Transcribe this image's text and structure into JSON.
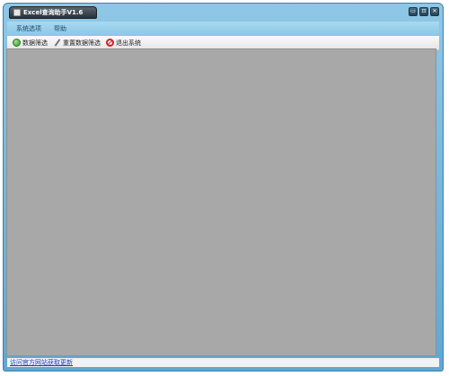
{
  "window": {
    "title": "Excel查询助手V1.6"
  },
  "window_controls": {
    "minimize_glyph": "▭",
    "restore_glyph": "⊡",
    "close_glyph": "✕"
  },
  "menubar": {
    "items": [
      {
        "label": "系统选项"
      },
      {
        "label": "帮助"
      }
    ]
  },
  "toolbar": {
    "items": [
      {
        "label": "数据筛选",
        "icon": "green-circle-icon"
      },
      {
        "label": "重置数据筛选",
        "icon": "pen-icon"
      },
      {
        "label": "退出系统",
        "icon": "no-entry-icon"
      }
    ]
  },
  "statusbar": {
    "link_text": "访问官方网站获取更新"
  },
  "colors": {
    "titlebar": "#5ea8d4",
    "menubar": "#a9d9f0",
    "workspace": "#a8a8a8",
    "link": "#1a3cc8"
  }
}
